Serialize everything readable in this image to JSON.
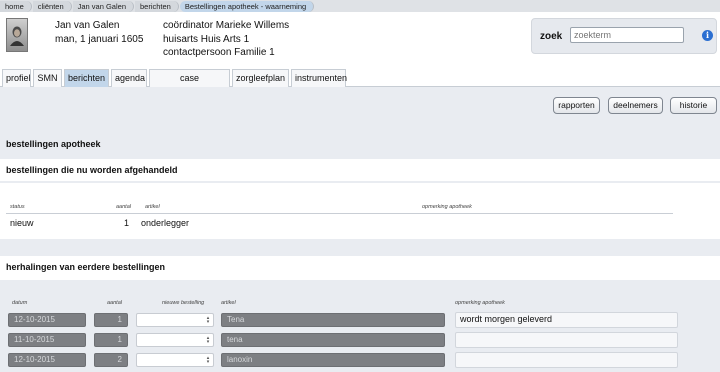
{
  "breadcrumb": [
    "home",
    "cliënten",
    "Jan van Galen",
    "berichten",
    "Bestellingen apotheek - waarneming"
  ],
  "patient": {
    "name": "Jan van Galen",
    "birth": "man, 1 januari 1605"
  },
  "contacts": {
    "coordinator": "coördinator Marieke Willems",
    "doctor": "huisarts Huis Arts 1",
    "contact": "contactpersoon Familie 1"
  },
  "search": {
    "label": "zoek",
    "placeholder": "zoekterm",
    "info_icon": "i"
  },
  "tabs": [
    "profiel",
    "SMN",
    "berichten",
    "agenda",
    "case management",
    "zorgleefplan",
    "instrumenten"
  ],
  "active_tab": "berichten",
  "actions": {
    "reports": "rapporten",
    "participants": "deelnemers",
    "history": "historie"
  },
  "page_title": "bestellingen apotheek",
  "current": {
    "title": "bestellingen die nu worden afgehandeld",
    "headers": {
      "status": "status",
      "count": "aantal",
      "article": "artikel",
      "note": "opmerking apotheek"
    },
    "rows": [
      {
        "status": "nieuw",
        "count": "1",
        "article": "onderlegger",
        "note": ""
      }
    ]
  },
  "previous": {
    "title": "herhalingen van eerdere bestellingen",
    "headers": {
      "date": "datum",
      "count": "aantal",
      "new_order": "nieuwe bestelling",
      "article": "artikel",
      "note": "opmerking apotheek"
    },
    "rows": [
      {
        "date": "12-10-2015",
        "count": "1",
        "new_order": "",
        "article": "Tena",
        "note": "wordt morgen geleverd"
      },
      {
        "date": "11-10-2015",
        "count": "1",
        "new_order": "",
        "article": "tena",
        "note": ""
      },
      {
        "date": "12-10-2015",
        "count": "2",
        "new_order": "",
        "article": "lanoxin",
        "note": ""
      }
    ]
  },
  "colors": {
    "active_tab": "#c2d6ea",
    "info": "#2b6fd1",
    "readonly_field": "#7d7f83"
  }
}
